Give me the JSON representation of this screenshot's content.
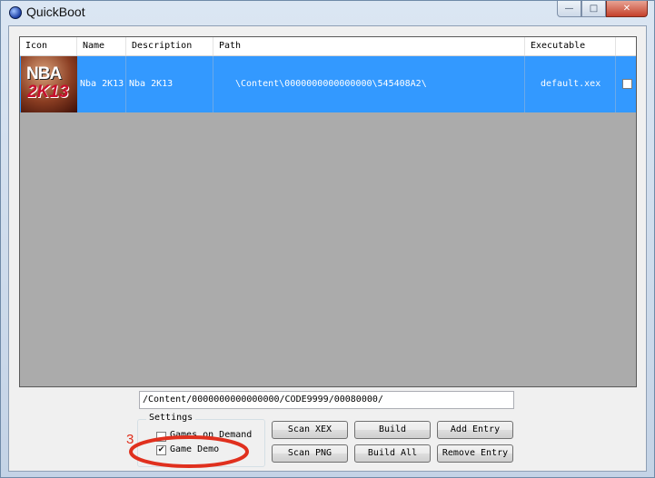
{
  "window": {
    "title": "QuickBoot",
    "controls": {
      "minimize": "—",
      "maximize": "□",
      "close": "✕"
    }
  },
  "list": {
    "columns": [
      "Icon",
      "Name",
      "Description",
      "Path",
      "Executable"
    ],
    "rows": [
      {
        "icon": "nba-2k13-cover-icon",
        "icon_text_top": "NBA",
        "icon_text_bottom": "2K13",
        "name": "Nba 2K13",
        "description": "Nba 2K13",
        "path": "\\Content\\0000000000000000\\545408A2\\",
        "executable": "default.xex",
        "checked": false,
        "selected": true
      }
    ]
  },
  "path_field": {
    "value": "/Content/0000000000000000/CODE9999/00080000/"
  },
  "settings": {
    "legend": "Settings",
    "games_on_demand": {
      "label": "Games on Demand",
      "checked": false
    },
    "game_demo": {
      "label": "Game Demo",
      "checked": true
    }
  },
  "buttons": {
    "scan_xex": "Scan XEX",
    "build": "Build",
    "add_entry": "Add Entry",
    "scan_png": "Scan PNG",
    "build_all": "Build All",
    "remove_entry": "Remove Entry"
  },
  "annotation": {
    "label": "3",
    "color": "#e0301e"
  },
  "colors": {
    "selection": "#3399ff",
    "list_background": "#ababab",
    "annotation": "#e0301e"
  }
}
